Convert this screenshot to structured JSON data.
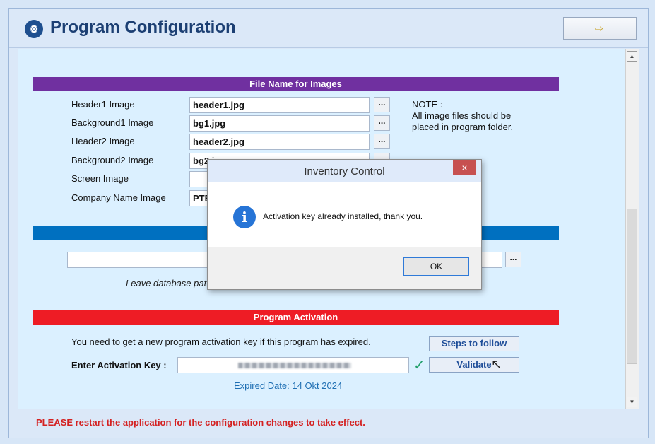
{
  "header": {
    "title": "Program Configuration",
    "app_icon": "gear-icon",
    "exit_icon": "exit-door-icon"
  },
  "images_section": {
    "title": "File Name for Images",
    "rows": [
      {
        "label": "Header1 Image",
        "value": "header1.jpg"
      },
      {
        "label": "Background1 Image",
        "value": "bg1.jpg"
      },
      {
        "label": "Header2 Image",
        "value": "header2.jpg"
      },
      {
        "label": "Background2 Image",
        "value": "bg2.jpg"
      },
      {
        "label": "Screen Image",
        "value": ""
      },
      {
        "label": "Company Name Image",
        "value": "PTBIT"
      }
    ],
    "browse_label": "...",
    "note_title": "NOTE :",
    "note_line1": "All image files should be",
    "note_line2": "placed in program folder."
  },
  "database_section": {
    "path_value": "",
    "hint": "Leave database pat",
    "browse_label": "..."
  },
  "activation_section": {
    "title": "Program Activation",
    "message": "You need to get a new program activation key if this program has expired.",
    "steps_button": "Steps to follow",
    "key_label": "Enter Activation Key :",
    "validate_button": "Validate",
    "check_mark": "✓",
    "expired_date": "Expired Date: 14 Okt 2024"
  },
  "status_bar": {
    "message": "PLEASE restart the application for the configuration changes to take effect."
  },
  "dialog": {
    "title": "Inventory Control",
    "close": "×",
    "message": "Activation key already installed, thank you.",
    "icon": "i",
    "ok_button": "OK"
  },
  "scrollbar": {
    "up": "▲",
    "down": "▼"
  },
  "colors": {
    "images_bar": "#7030a0",
    "db_bar": "#0070c0",
    "activation_bar": "#ee1c25",
    "warning_text": "#d42121"
  }
}
